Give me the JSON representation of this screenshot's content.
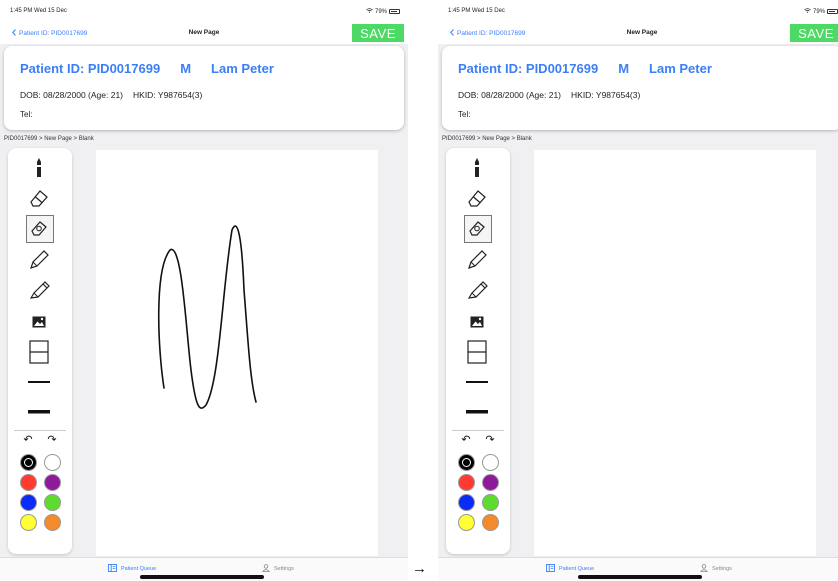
{
  "arrow": "→",
  "screens": [
    {
      "status": {
        "time": "1:45 PM  Wed 15 Dec",
        "battery": "79%"
      },
      "nav": {
        "back_label": "Patient ID: PID0017699",
        "title": "New Page",
        "save_label": "SAVE"
      },
      "patient": {
        "id_label": "Patient ID: PID0017699",
        "sex": "M",
        "name": "Lam Peter",
        "dob": "DOB: 08/28/2000 (Age: 21)",
        "hkid": "HKID: Y987654(3)",
        "tel": "Tel:"
      },
      "breadcrumb": "PID0017699 > New Page > Blank",
      "tabs": {
        "queue": "Patient Queue",
        "settings": "Settings"
      },
      "canvas": {
        "has_drawing": true
      }
    },
    {
      "status": {
        "time": "1:45 PM  Wed 15 Dec",
        "battery": "79%"
      },
      "nav": {
        "back_label": "Patient ID: PID0017699",
        "title": "New Page",
        "save_label": "SAVE"
      },
      "patient": {
        "id_label": "Patient ID: PID0017699",
        "sex": "M",
        "name": "Lam Peter",
        "dob": "DOB: 08/28/2000 (Age: 21)",
        "hkid": "HKID: Y987654(3)",
        "tel": "Tel:"
      },
      "breadcrumb": "PID0017699 > New Page > Blank",
      "tabs": {
        "queue": "Patient Queue",
        "settings": "Settings"
      },
      "canvas": {
        "has_drawing": false
      }
    }
  ],
  "tools": [
    {
      "icon": "pen-icon"
    },
    {
      "icon": "eraser-icon"
    },
    {
      "icon": "stroke-eraser-icon",
      "selected": true
    },
    {
      "icon": "pencil-icon"
    },
    {
      "icon": "highlighter-icon"
    },
    {
      "icon": "image-icon"
    },
    {
      "icon": "template-lines-icon"
    },
    {
      "icon": "thin-line-icon"
    },
    {
      "icon": "thick-line-icon"
    }
  ],
  "colors": [
    "#000000",
    "#ffffff",
    "#ff3b30",
    "#8e1a9b",
    "#0a2cf5",
    "#5ddc2f",
    "#ffff33",
    "#f48a2a"
  ],
  "selected_color": "#000000"
}
